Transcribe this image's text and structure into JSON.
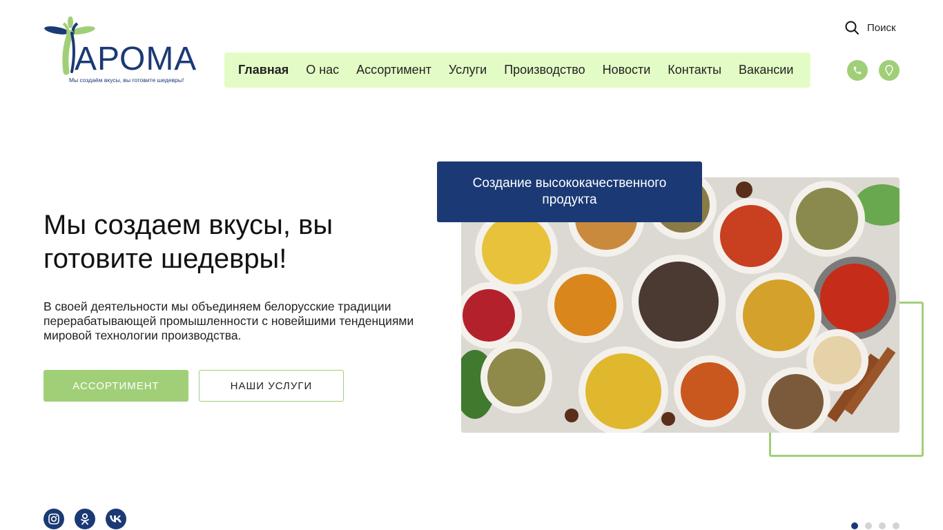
{
  "brand": {
    "logo_text": "АРОМА",
    "tagline": "Мы создаём вкусы, вы готовите шедевры!",
    "colors": {
      "primary": "#1b3a75",
      "accent": "#a1cf78",
      "nav_bg": "#e3fcc5"
    }
  },
  "header": {
    "search_label": "Поиск",
    "nav": [
      {
        "label": "Главная",
        "active": true
      },
      {
        "label": "О нас",
        "active": false
      },
      {
        "label": "Ассортимент",
        "active": false
      },
      {
        "label": "Услуги",
        "active": false
      },
      {
        "label": "Производство",
        "active": false
      },
      {
        "label": "Новости",
        "active": false
      },
      {
        "label": "Контакты",
        "active": false
      },
      {
        "label": "Вакансии",
        "active": false
      }
    ],
    "icons": [
      "phone-icon",
      "map-pin-icon"
    ]
  },
  "hero": {
    "title": "Мы создаем вкусы, вы готовите шедевры!",
    "text": "В своей деятельности мы объединяем белорусские традиции перерабатывающей промышленности с новейшими тенденциями мировой технологии производства.",
    "primary_button": "АССОРТИМЕНТ",
    "secondary_button": "НАШИ УСЛУГИ",
    "caption": "Создание высококачественного продукта"
  },
  "social": [
    "instagram-icon",
    "odnoklassniki-icon",
    "vk-icon"
  ],
  "slider": {
    "total": 4,
    "active": 1
  }
}
